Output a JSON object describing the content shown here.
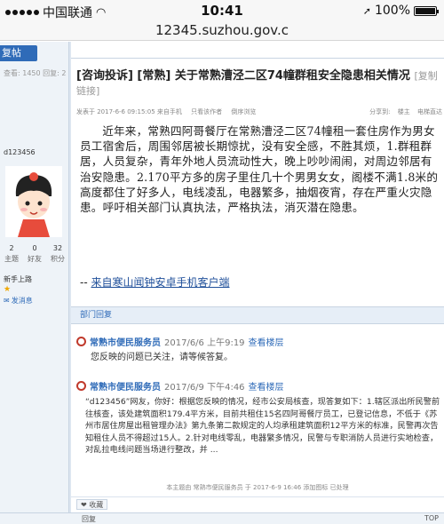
{
  "status_bar": {
    "carrier": "中国联通",
    "time": "10:41",
    "battery": "100%"
  },
  "browser": {
    "url": "12345.suzhou.gov.c"
  },
  "sidebar": {
    "reply_button": "复帖",
    "view_count": "查看: 1450 回复: 2",
    "username": "d123456",
    "stats": [
      {
        "value": "2",
        "label": "主题"
      },
      {
        "value": "0",
        "label": "好友"
      },
      {
        "value": "32",
        "label": "积分"
      }
    ],
    "rank": "新手上路",
    "stars": "★",
    "send_message": "发消息"
  },
  "thread": {
    "title": "[咨询投诉] [常熟] 关于常熟漕泾二区74幢群租安全隐患相关情况",
    "title_extra": "[复制链接]",
    "meta_left": [
      "发表于 2017-6-6 09:15:05 来自手机",
      "只看该作者",
      "倒序浏览"
    ],
    "meta_right": [
      "分享到:",
      "楼主",
      "电梯直达"
    ],
    "post": "近年来，常熟四阿哥餐厅在常熟漕泾二区74幢租一套住房作为男女员工宿舍后，周围邻居被长期惊扰，没有安全感，不胜其烦，1.群租群居，人员复杂，青年外地人员流动性大，晚上吵吵闹闹，对周边邻居有治安隐患。2.170平方多的房子里住几十个男男女女，阁楼不满1.8米的高度都住了好多人，电线凌乱，电器繁多，抽烟夜宵，存在严重火灾隐患。呼吁相关部门认真执法，严格执法，消灭潜在隐患。",
    "source_prefix": "-- ",
    "source_link": "来自寒山闻钟安卓手机客户端"
  },
  "dept_section": {
    "label": "部门回复"
  },
  "replies": [
    {
      "name": "常熟市便民服务员",
      "date": "2017/6/6 上午9:19",
      "view": "查看楼层",
      "body": "您反映的问题已关注，请等候答复。"
    },
    {
      "name": "常熟市便民服务员",
      "date": "2017/6/9 下午4:46",
      "view": "查看楼层",
      "body": "“d123456”网友，你好：根据您反映的情况，经市公安局核查，现答复如下：1.辖区派出所民警前往核查，该处建筑面积179.4平方米，目前共租住15名四阿哥餐厅员工，已登记信息，不低于《苏州市居住房屋出租管理办法》第九条第二款规定的人均承租建筑面积12平方米的标准，民警再次告知租住人员不得超过15人。2.针对电线零乱，电器繁多情况，民警与专职消防人员进行实地检查，对乱拉电线问题当场进行整改，并 ..."
    }
  ],
  "edit_note": "本主题由 常熟市便民服务员 于 2017-6-9 16:46 添加图标 已处理",
  "collect_label": "收藏",
  "bottom_bar": {
    "back": "回复",
    "top": "TOP"
  }
}
